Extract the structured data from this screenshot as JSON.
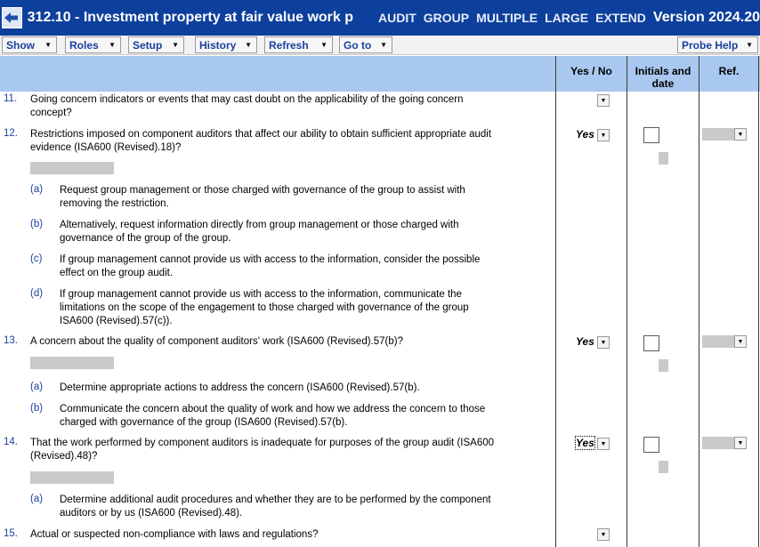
{
  "window": {
    "title": "312.10 - Investment property at fair value work p",
    "tags": [
      "AUDIT",
      "GROUP",
      "MULTIPLE",
      "LARGE",
      "EXTEND"
    ],
    "version": "Version 2024.20"
  },
  "menu": {
    "show": "Show",
    "roles": "Roles",
    "setup": "Setup",
    "history": "History",
    "refresh": "Refresh",
    "goto": "Go to",
    "probe_help": "Probe Help"
  },
  "columns": {
    "yes_no": "Yes / No",
    "initials_line1": "Initials and",
    "initials_line2": "date",
    "ref": "Ref."
  },
  "rows": [
    {
      "num": "11.",
      "text": "Going concern indicators or events that may cast doubt on the applicability of the going concern concept?",
      "answer": ""
    },
    {
      "num": "12.",
      "text": "Restrictions imposed on component auditors that affect our ability to obtain sufficient appropriate audit evidence (ISA600 (Revised).18)?",
      "answer": "Yes",
      "subs": [
        {
          "letter": "(a)",
          "text": "Request group management or those charged with governance of the group to assist with removing the restriction."
        },
        {
          "letter": "(b)",
          "text": "Alternatively, request information directly from group management or those charged with governance of the group of the group."
        },
        {
          "letter": "(c)",
          "text": "If group management cannot provide us with access to the information, consider the possible effect on the group audit."
        },
        {
          "letter": "(d)",
          "text": "If group management cannot provide us with access to the information, communicate the limitations on the scope of the engagement to those charged with governance of the group ISA600 (Revised).57(c))."
        }
      ]
    },
    {
      "num": "13.",
      "text": "A concern about the quality of component auditors' work (ISA600 (Revised).57(b)?",
      "answer": "Yes",
      "subs": [
        {
          "letter": "(a)",
          "text": "Determine appropriate actions to address the concern (ISA600 (Revised).57(b)."
        },
        {
          "letter": "(b)",
          "text": "Communicate the concern about the quality of work and how we address the concern to those charged with governance of the group (ISA600 (Revised).57(b)."
        }
      ]
    },
    {
      "num": "14.",
      "text": "That the work performed by component auditors is inadequate for purposes of the group audit (ISA600 (Revised).48)?",
      "answer": "Yes",
      "subs": [
        {
          "letter": "(a)",
          "text": "Determine additional audit procedures and whether they are to be performed by the component auditors or by us (ISA600 (Revised).48)."
        }
      ]
    },
    {
      "num": "15.",
      "text": "Actual or suspected non-compliance with laws and regulations?",
      "answer": ""
    }
  ],
  "icons": {
    "back": "back-arrow-icon",
    "dropdown": "triangle-down-icon"
  },
  "colors": {
    "titlebar": "#0d3f9c",
    "header": "#a9c8ef",
    "accent_text": "#1a3f9e",
    "placeholder": "#c9c9c9"
  }
}
